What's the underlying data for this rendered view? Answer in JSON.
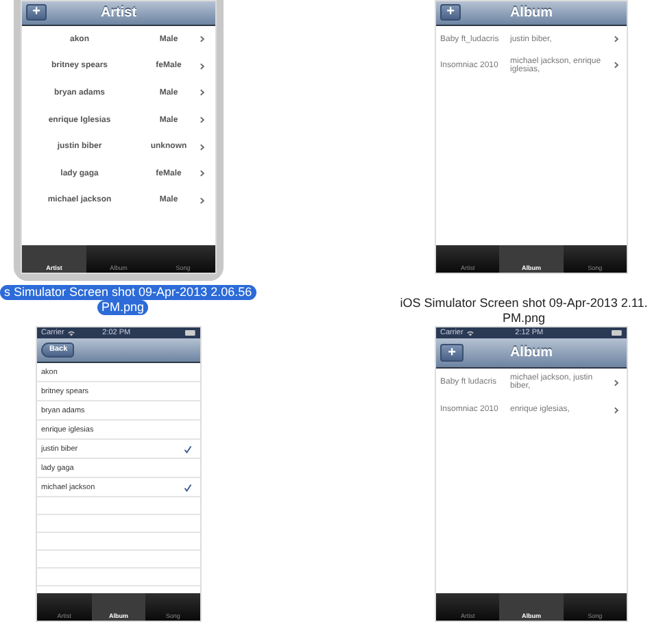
{
  "files": [
    {
      "selected": true,
      "label_lines": [
        "s Simulator Screen shot 09-Apr-2013 2.06.56",
        "PM.png"
      ],
      "screen": {
        "nav": {
          "title": "Artist",
          "button": {
            "kind": "add",
            "label": "+"
          }
        },
        "rows": [
          {
            "kind": "artist",
            "name": "akon",
            "gender": "Male"
          },
          {
            "kind": "artist",
            "name": "britney spears",
            "gender": "feMale"
          },
          {
            "kind": "artist",
            "name": "bryan adams",
            "gender": "Male"
          },
          {
            "kind": "artist",
            "name": "enrique Iglesias",
            "gender": "Male"
          },
          {
            "kind": "artist",
            "name": "justin biber",
            "gender": "unknown"
          },
          {
            "kind": "artist",
            "name": "lady gaga",
            "gender": "feMale"
          },
          {
            "kind": "artist",
            "name": "michael jackson",
            "gender": "Male"
          }
        ],
        "tabs": [
          {
            "label": "Artist",
            "selected": true
          },
          {
            "label": "Album",
            "selected": false
          },
          {
            "label": "Song",
            "selected": false
          }
        ]
      }
    },
    {
      "selected": false,
      "label_lines": [
        "iOS Simulator Screen shot 09-Apr-2013 2.11.",
        "PM.png"
      ],
      "screen": {
        "nav": {
          "title": "Album",
          "button": {
            "kind": "add",
            "label": "+"
          }
        },
        "rows": [
          {
            "kind": "album",
            "title": "Baby ft_ludacris",
            "artists": "justin biber,"
          },
          {
            "kind": "album",
            "title": "Insomniac 2010",
            "artists": "michael jackson, enrique iglesias,"
          }
        ],
        "tabs": [
          {
            "label": "Artist",
            "selected": false
          },
          {
            "label": "Album",
            "selected": true
          },
          {
            "label": "Song",
            "selected": false
          }
        ]
      }
    },
    {
      "selected": false,
      "screen": {
        "status": {
          "carrier": "Carrier",
          "time": "2:02 PM"
        },
        "nav": {
          "button": {
            "kind": "back",
            "label": "Back"
          }
        },
        "rows": [
          {
            "kind": "check",
            "name": "akon",
            "checked": false
          },
          {
            "kind": "check",
            "name": "britney spears",
            "checked": false
          },
          {
            "kind": "check",
            "name": "bryan adams",
            "checked": false
          },
          {
            "kind": "check",
            "name": "enrique iglesias",
            "checked": false
          },
          {
            "kind": "check",
            "name": "justin biber",
            "checked": true
          },
          {
            "kind": "check",
            "name": "lady gaga",
            "checked": false
          },
          {
            "kind": "check",
            "name": "michael jackson",
            "checked": true
          }
        ],
        "tabs": [
          {
            "label": "Artist",
            "selected": false
          },
          {
            "label": "Album",
            "selected": true
          },
          {
            "label": "Song",
            "selected": false
          }
        ]
      }
    },
    {
      "selected": false,
      "screen": {
        "status": {
          "carrier": "Carrier",
          "time": "2:12 PM"
        },
        "nav": {
          "title": "Album",
          "button": {
            "kind": "add",
            "label": "+"
          }
        },
        "rows": [
          {
            "kind": "album",
            "title": "Baby ft ludacris",
            "artists": "michael jackson, justin biber,"
          },
          {
            "kind": "album",
            "title": "Insomniac 2010",
            "artists": "enrique iglesias,"
          }
        ],
        "tabs": [
          {
            "label": "Artist",
            "selected": false
          },
          {
            "label": "Album",
            "selected": true
          },
          {
            "label": "Song",
            "selected": false
          }
        ]
      }
    }
  ]
}
